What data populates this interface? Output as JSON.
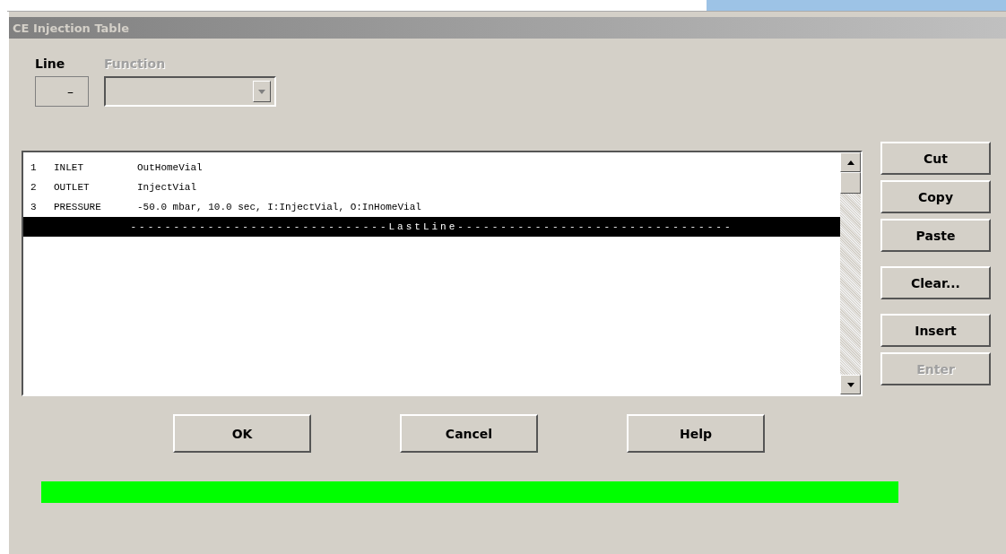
{
  "window": {
    "title": "CE Injection Table"
  },
  "line_field": {
    "label": "Line",
    "value": "–"
  },
  "function_field": {
    "label": "Function",
    "disabled": true
  },
  "table": {
    "rows": [
      {
        "kind": "entry",
        "number": "1",
        "function": "INLET",
        "params": "OutHomeVial",
        "selected": false
      },
      {
        "kind": "entry",
        "number": "2",
        "function": "OUTLET",
        "params": "InjectVial",
        "selected": false
      },
      {
        "kind": "entry",
        "number": "3",
        "function": "PRESSURE",
        "params": "-50.0 mbar, 10.0 sec, I:InjectVial, O:InHomeVial",
        "selected": false
      },
      {
        "kind": "marker",
        "text": "------------------------------LastLine--------------------------------",
        "selected": true
      }
    ]
  },
  "side_button_groups": [
    [
      {
        "label": "Cut",
        "disabled": false
      },
      {
        "label": "Copy",
        "disabled": false
      },
      {
        "label": "Paste",
        "disabled": false
      }
    ],
    [
      {
        "label": "Clear...",
        "disabled": false
      }
    ],
    [
      {
        "label": "Insert",
        "disabled": false
      },
      {
        "label": "Enter",
        "disabled": true
      }
    ]
  ],
  "buttons": [
    "OK",
    "Cancel",
    "Help"
  ]
}
